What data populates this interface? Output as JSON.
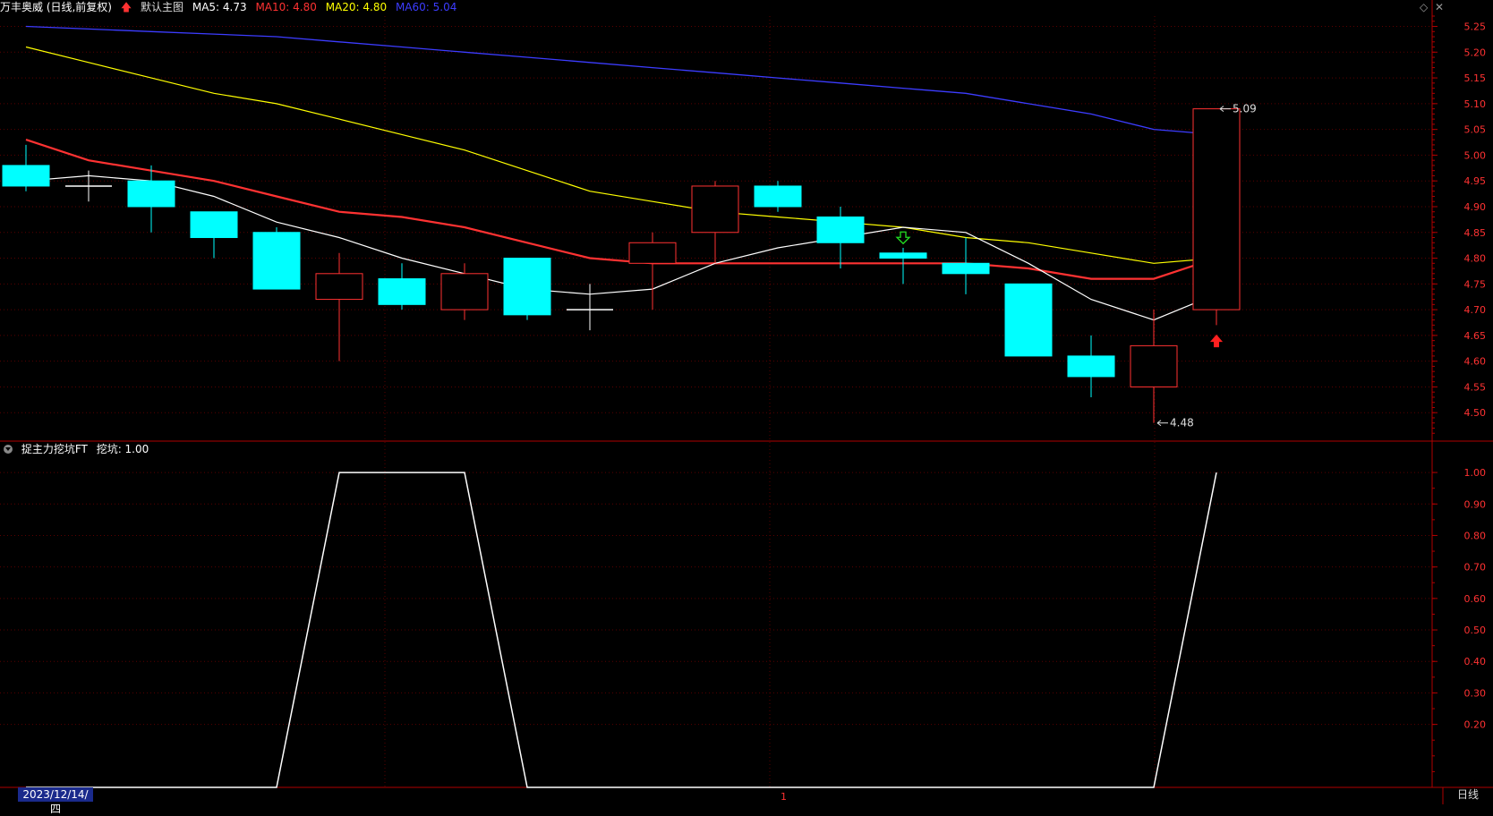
{
  "main_header": {
    "stock": "万丰奥威 (日线,前复权)",
    "template": "默认主图",
    "ma5": "MA5: 4.73",
    "ma10": "MA10: 4.80",
    "ma20": "MA20: 4.80",
    "ma60": "MA60: 5.04"
  },
  "sub_header": {
    "indicator": "捉主力挖坑FT",
    "value": "挖坑: 1.00"
  },
  "footer": {
    "date": "2023/12/14/四",
    "period": "日线",
    "marker": "1"
  },
  "icons": {
    "expand": "◇",
    "close": "✕"
  },
  "colors": {
    "up": "#ff3232",
    "down": "#00ffff",
    "ma5": "#ffffff",
    "ma10": "#ff3232",
    "ma20": "#ffff00",
    "ma60": "#3c3cff",
    "axis": "#b00000",
    "grid": "#5a0000"
  },
  "chart_data": [
    {
      "type": "candlestick",
      "name": "price",
      "yticks": [
        4.5,
        4.55,
        4.6,
        4.65,
        4.7,
        4.75,
        4.8,
        4.85,
        4.9,
        4.95,
        5.0,
        5.05,
        5.1,
        5.15,
        5.2,
        5.25
      ],
      "ylim": [
        4.45,
        5.27
      ],
      "candles": [
        {
          "o": 4.98,
          "h": 5.02,
          "l": 4.93,
          "c": 4.94
        },
        {
          "o": 4.94,
          "h": 4.97,
          "l": 4.91,
          "c": 4.94
        },
        {
          "o": 4.95,
          "h": 4.98,
          "l": 4.85,
          "c": 4.9
        },
        {
          "o": 4.89,
          "h": 4.89,
          "l": 4.8,
          "c": 4.84
        },
        {
          "o": 4.85,
          "h": 4.86,
          "l": 4.74,
          "c": 4.74
        },
        {
          "o": 4.72,
          "h": 4.81,
          "l": 4.6,
          "c": 4.77
        },
        {
          "o": 4.76,
          "h": 4.79,
          "l": 4.7,
          "c": 4.71
        },
        {
          "o": 4.7,
          "h": 4.79,
          "l": 4.68,
          "c": 4.77
        },
        {
          "o": 4.8,
          "h": 4.8,
          "l": 4.68,
          "c": 4.69
        },
        {
          "o": 4.7,
          "h": 4.75,
          "l": 4.66,
          "c": 4.7
        },
        {
          "o": 4.79,
          "h": 4.85,
          "l": 4.7,
          "c": 4.83
        },
        {
          "o": 4.85,
          "h": 4.95,
          "l": 4.79,
          "c": 4.94
        },
        {
          "o": 4.94,
          "h": 4.95,
          "l": 4.89,
          "c": 4.9
        },
        {
          "o": 4.88,
          "h": 4.9,
          "l": 4.78,
          "c": 4.83
        },
        {
          "o": 4.81,
          "h": 4.82,
          "l": 4.75,
          "c": 4.8
        },
        {
          "o": 4.79,
          "h": 4.84,
          "l": 4.73,
          "c": 4.77
        },
        {
          "o": 4.75,
          "h": 4.75,
          "l": 4.61,
          "c": 4.61
        },
        {
          "o": 4.61,
          "h": 4.65,
          "l": 4.53,
          "c": 4.57
        },
        {
          "o": 4.55,
          "h": 4.7,
          "l": 4.48,
          "c": 4.63
        },
        {
          "o": 4.7,
          "h": 5.09,
          "l": 4.67,
          "c": 5.09
        }
      ],
      "ma5": [
        4.95,
        4.96,
        4.95,
        4.92,
        4.87,
        4.84,
        4.8,
        4.77,
        4.74,
        4.73,
        4.74,
        4.79,
        4.82,
        4.84,
        4.86,
        4.85,
        4.79,
        4.72,
        4.68,
        4.73
      ],
      "ma10": [
        5.03,
        4.99,
        4.97,
        4.95,
        4.92,
        4.89,
        4.88,
        4.86,
        4.83,
        4.8,
        4.79,
        4.79,
        4.79,
        4.79,
        4.79,
        4.79,
        4.78,
        4.76,
        4.76,
        4.8
      ],
      "ma20": [
        5.21,
        5.18,
        5.15,
        5.12,
        5.1,
        5.07,
        5.04,
        5.01,
        4.97,
        4.93,
        4.91,
        4.89,
        4.88,
        4.87,
        4.86,
        4.84,
        4.83,
        4.81,
        4.79,
        4.8
      ],
      "ma60": [
        5.25,
        5.245,
        5.24,
        5.235,
        5.23,
        5.22,
        5.21,
        5.2,
        5.19,
        5.18,
        5.17,
        5.16,
        5.15,
        5.14,
        5.13,
        5.12,
        5.1,
        5.08,
        5.05,
        5.04
      ],
      "annotations": [
        {
          "index": 19,
          "value": 5.09,
          "label": "5.09",
          "side": "high"
        },
        {
          "index": 18,
          "value": 4.48,
          "label": "4.48",
          "side": "low"
        }
      ],
      "signals": [
        {
          "index": 14,
          "kind": "sell",
          "value": 4.83
        },
        {
          "index": 19,
          "kind": "buy",
          "value": 4.64
        }
      ]
    },
    {
      "type": "line",
      "name": "挖坑",
      "yticks": [
        0.2,
        0.3,
        0.4,
        0.5,
        0.6,
        0.7,
        0.8,
        0.9,
        1.0
      ],
      "ylim": [
        0,
        1.04
      ],
      "values": [
        0,
        0,
        0,
        0,
        0,
        1,
        1,
        1,
        0,
        0,
        0,
        0,
        0,
        0,
        0,
        0,
        0,
        0,
        0,
        1
      ]
    }
  ]
}
